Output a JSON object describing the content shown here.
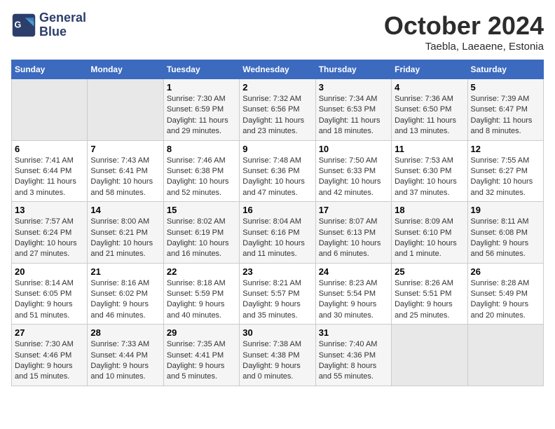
{
  "logo": {
    "line1": "General",
    "line2": "Blue"
  },
  "title": "October 2024",
  "subtitle": "Taebla, Laeaene, Estonia",
  "days_header": [
    "Sunday",
    "Monday",
    "Tuesday",
    "Wednesday",
    "Thursday",
    "Friday",
    "Saturday"
  ],
  "weeks": [
    [
      {
        "day": "",
        "info": ""
      },
      {
        "day": "",
        "info": ""
      },
      {
        "day": "1",
        "sunrise": "Sunrise: 7:30 AM",
        "sunset": "Sunset: 6:59 PM",
        "daylight": "Daylight: 11 hours and 29 minutes."
      },
      {
        "day": "2",
        "sunrise": "Sunrise: 7:32 AM",
        "sunset": "Sunset: 6:56 PM",
        "daylight": "Daylight: 11 hours and 23 minutes."
      },
      {
        "day": "3",
        "sunrise": "Sunrise: 7:34 AM",
        "sunset": "Sunset: 6:53 PM",
        "daylight": "Daylight: 11 hours and 18 minutes."
      },
      {
        "day": "4",
        "sunrise": "Sunrise: 7:36 AM",
        "sunset": "Sunset: 6:50 PM",
        "daylight": "Daylight: 11 hours and 13 minutes."
      },
      {
        "day": "5",
        "sunrise": "Sunrise: 7:39 AM",
        "sunset": "Sunset: 6:47 PM",
        "daylight": "Daylight: 11 hours and 8 minutes."
      }
    ],
    [
      {
        "day": "6",
        "sunrise": "Sunrise: 7:41 AM",
        "sunset": "Sunset: 6:44 PM",
        "daylight": "Daylight: 11 hours and 3 minutes."
      },
      {
        "day": "7",
        "sunrise": "Sunrise: 7:43 AM",
        "sunset": "Sunset: 6:41 PM",
        "daylight": "Daylight: 10 hours and 58 minutes."
      },
      {
        "day": "8",
        "sunrise": "Sunrise: 7:46 AM",
        "sunset": "Sunset: 6:38 PM",
        "daylight": "Daylight: 10 hours and 52 minutes."
      },
      {
        "day": "9",
        "sunrise": "Sunrise: 7:48 AM",
        "sunset": "Sunset: 6:36 PM",
        "daylight": "Daylight: 10 hours and 47 minutes."
      },
      {
        "day": "10",
        "sunrise": "Sunrise: 7:50 AM",
        "sunset": "Sunset: 6:33 PM",
        "daylight": "Daylight: 10 hours and 42 minutes."
      },
      {
        "day": "11",
        "sunrise": "Sunrise: 7:53 AM",
        "sunset": "Sunset: 6:30 PM",
        "daylight": "Daylight: 10 hours and 37 minutes."
      },
      {
        "day": "12",
        "sunrise": "Sunrise: 7:55 AM",
        "sunset": "Sunset: 6:27 PM",
        "daylight": "Daylight: 10 hours and 32 minutes."
      }
    ],
    [
      {
        "day": "13",
        "sunrise": "Sunrise: 7:57 AM",
        "sunset": "Sunset: 6:24 PM",
        "daylight": "Daylight: 10 hours and 27 minutes."
      },
      {
        "day": "14",
        "sunrise": "Sunrise: 8:00 AM",
        "sunset": "Sunset: 6:21 PM",
        "daylight": "Daylight: 10 hours and 21 minutes."
      },
      {
        "day": "15",
        "sunrise": "Sunrise: 8:02 AM",
        "sunset": "Sunset: 6:19 PM",
        "daylight": "Daylight: 10 hours and 16 minutes."
      },
      {
        "day": "16",
        "sunrise": "Sunrise: 8:04 AM",
        "sunset": "Sunset: 6:16 PM",
        "daylight": "Daylight: 10 hours and 11 minutes."
      },
      {
        "day": "17",
        "sunrise": "Sunrise: 8:07 AM",
        "sunset": "Sunset: 6:13 PM",
        "daylight": "Daylight: 10 hours and 6 minutes."
      },
      {
        "day": "18",
        "sunrise": "Sunrise: 8:09 AM",
        "sunset": "Sunset: 6:10 PM",
        "daylight": "Daylight: 10 hours and 1 minute."
      },
      {
        "day": "19",
        "sunrise": "Sunrise: 8:11 AM",
        "sunset": "Sunset: 6:08 PM",
        "daylight": "Daylight: 9 hours and 56 minutes."
      }
    ],
    [
      {
        "day": "20",
        "sunrise": "Sunrise: 8:14 AM",
        "sunset": "Sunset: 6:05 PM",
        "daylight": "Daylight: 9 hours and 51 minutes."
      },
      {
        "day": "21",
        "sunrise": "Sunrise: 8:16 AM",
        "sunset": "Sunset: 6:02 PM",
        "daylight": "Daylight: 9 hours and 46 minutes."
      },
      {
        "day": "22",
        "sunrise": "Sunrise: 8:18 AM",
        "sunset": "Sunset: 5:59 PM",
        "daylight": "Daylight: 9 hours and 40 minutes."
      },
      {
        "day": "23",
        "sunrise": "Sunrise: 8:21 AM",
        "sunset": "Sunset: 5:57 PM",
        "daylight": "Daylight: 9 hours and 35 minutes."
      },
      {
        "day": "24",
        "sunrise": "Sunrise: 8:23 AM",
        "sunset": "Sunset: 5:54 PM",
        "daylight": "Daylight: 9 hours and 30 minutes."
      },
      {
        "day": "25",
        "sunrise": "Sunrise: 8:26 AM",
        "sunset": "Sunset: 5:51 PM",
        "daylight": "Daylight: 9 hours and 25 minutes."
      },
      {
        "day": "26",
        "sunrise": "Sunrise: 8:28 AM",
        "sunset": "Sunset: 5:49 PM",
        "daylight": "Daylight: 9 hours and 20 minutes."
      }
    ],
    [
      {
        "day": "27",
        "sunrise": "Sunrise: 7:30 AM",
        "sunset": "Sunset: 4:46 PM",
        "daylight": "Daylight: 9 hours and 15 minutes."
      },
      {
        "day": "28",
        "sunrise": "Sunrise: 7:33 AM",
        "sunset": "Sunset: 4:44 PM",
        "daylight": "Daylight: 9 hours and 10 minutes."
      },
      {
        "day": "29",
        "sunrise": "Sunrise: 7:35 AM",
        "sunset": "Sunset: 4:41 PM",
        "daylight": "Daylight: 9 hours and 5 minutes."
      },
      {
        "day": "30",
        "sunrise": "Sunrise: 7:38 AM",
        "sunset": "Sunset: 4:38 PM",
        "daylight": "Daylight: 9 hours and 0 minutes."
      },
      {
        "day": "31",
        "sunrise": "Sunrise: 7:40 AM",
        "sunset": "Sunset: 4:36 PM",
        "daylight": "Daylight: 8 hours and 55 minutes."
      },
      {
        "day": "",
        "info": ""
      },
      {
        "day": "",
        "info": ""
      }
    ]
  ]
}
